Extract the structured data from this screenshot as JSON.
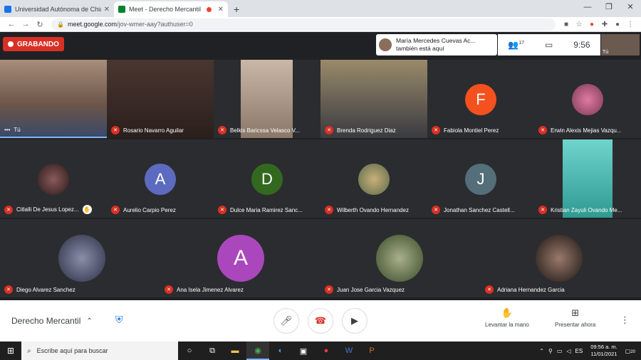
{
  "browser": {
    "tabs": [
      {
        "title": "Universidad Autónoma de Chiap",
        "favicon_color": "#1a73e8",
        "active": false
      },
      {
        "title": "Meet - Derecho Mercantil",
        "favicon_color": "#00832d",
        "active": true,
        "recording": true
      }
    ],
    "new_tab": "+",
    "url_host": "meet.google.com",
    "url_path": "/jov-wmer-aay?authuser=0"
  },
  "meet": {
    "recording_label": "GRABANDO",
    "notification": {
      "line1": "María Mercedes Cuevas Ac...",
      "line2": "también está aquí"
    },
    "participant_count": "17",
    "clock": "9:56",
    "self_label": "Tú",
    "tiles": [
      {
        "name": "Tú",
        "kind": "video",
        "bg": "#6a5448"
      },
      {
        "name": "Rosario Navarro Aguilar",
        "kind": "video",
        "bg": "#3a2a26"
      },
      {
        "name": "Belkis Baricssa Velasco V...",
        "kind": "video",
        "bg": "#9b8a7e"
      },
      {
        "name": "Brenda Rodriguez Diaz",
        "kind": "video",
        "bg": "#7b6e5c"
      },
      {
        "name": "Fabiola Montiel Perez",
        "kind": "avatar",
        "letter": "F",
        "color": "#f4511e"
      },
      {
        "name": "Erwin Alexis Mejias Vazqu...",
        "kind": "photo",
        "color": "#c2477a"
      },
      {
        "name": "Citlalli De Jesus Lopez...",
        "kind": "photo",
        "color": "#5a3a3a",
        "hand": true
      },
      {
        "name": "Aurelio Carpio Perez",
        "kind": "avatar",
        "letter": "A",
        "color": "#5c6bc0"
      },
      {
        "name": "Dulce Maria Ramirez Sanc...",
        "kind": "avatar",
        "letter": "D",
        "color": "#33691e"
      },
      {
        "name": "Wilberth Ovando Hernandez",
        "kind": "photo",
        "color": "#8f9e6a"
      },
      {
        "name": "Jonathan Sanchez Castell...",
        "kind": "avatar",
        "letter": "J",
        "color": "#546e7a"
      },
      {
        "name": "Kristian Zayuli Ovando Me...",
        "kind": "video",
        "bg": "#3fb8b0"
      },
      {
        "name": "Diego Alvarez Sanchez",
        "kind": "photo",
        "color": "#4a4f6a"
      },
      {
        "name": "Ana Isela Jimenez Alvarez",
        "kind": "avatar",
        "letter": "A",
        "color": "#ab47bc"
      },
      {
        "name": "Juan Jose Garcia Vazquez",
        "kind": "photo",
        "color": "#6d7a5a"
      },
      {
        "name": "Adriana Hernandez Garcia",
        "kind": "photo",
        "color": "#3b2f2f"
      }
    ]
  },
  "controls": {
    "meeting_name": "Derecho Mercantil",
    "raise_hand": "Levantar la mano",
    "present_now": "Presentar ahora"
  },
  "taskbar": {
    "search_placeholder": "Escribe aquí para buscar",
    "time": "09:56 a. m.",
    "date": "11/01/2021",
    "notifications": "20"
  }
}
